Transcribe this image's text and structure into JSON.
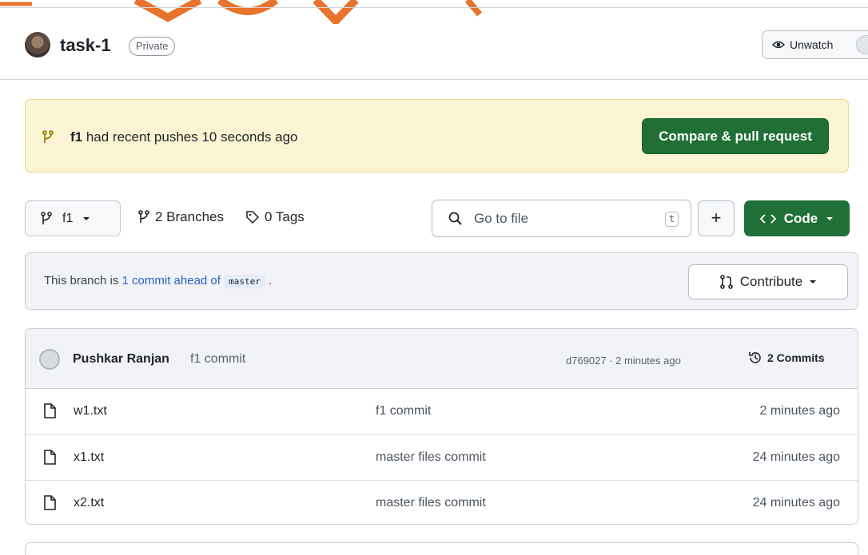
{
  "repo": {
    "name": "task-1",
    "visibility": "Private",
    "unwatch_label": "Unwatch"
  },
  "flash": {
    "branch": "f1",
    "message": " had recent pushes 10 seconds ago",
    "button": "Compare & pull request"
  },
  "toolbar": {
    "branch": "f1",
    "branches": "2 Branches",
    "tags": "0 Tags",
    "goto_placeholder": "Go to file",
    "goto_shortcut": "t",
    "add_label": "+",
    "code_label": "Code"
  },
  "branch_info": {
    "prefix": "This branch is ",
    "link": "1 commit ahead of",
    "base": "master",
    "suffix": ".",
    "contribute": "Contribute"
  },
  "latest_commit": {
    "author": "Pushkar Ranjan",
    "message": "f1 commit",
    "hash_time": "d769027 · 2 minutes ago",
    "commits": "2 Commits"
  },
  "files": [
    {
      "name": "w1.txt",
      "message": "f1 commit",
      "date": "2 minutes ago"
    },
    {
      "name": "x1.txt",
      "message": "master files commit",
      "date": "24 minutes ago"
    },
    {
      "name": "x2.txt",
      "message": "master files commit",
      "date": "24 minutes ago"
    }
  ],
  "colors": {
    "primary_green": "#1f6f36",
    "flash_bg": "#fbf5d4",
    "link_blue": "#2563c9",
    "watermark": "#e8732c"
  }
}
